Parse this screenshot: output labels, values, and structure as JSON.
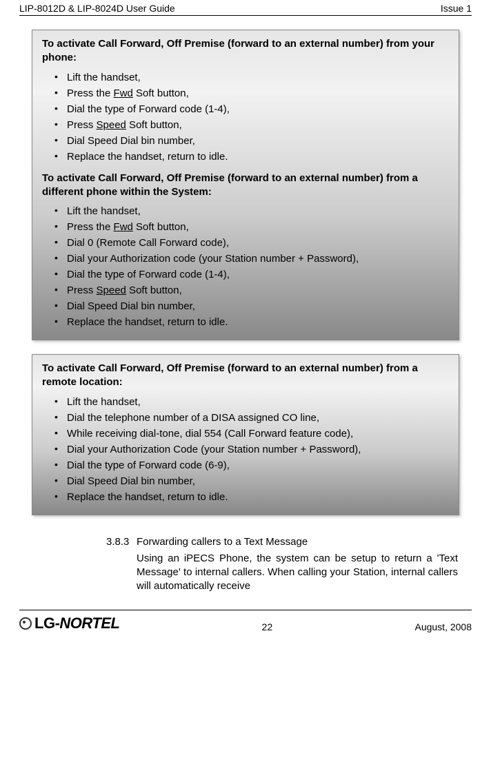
{
  "header": {
    "left": "LIP-8012D & LIP-8024D User Guide",
    "right": "Issue 1"
  },
  "box1": {
    "title": "To activate Call Forward, Off Premise (forward to an external number) from your phone:",
    "items": {
      "a": "Lift the handset,",
      "b_pre": "Press the ",
      "b_u": "Fwd",
      "b_post": " Soft button,",
      "c": "Dial the type of Forward code (1-4),",
      "d_pre": "Press ",
      "d_u": "Speed",
      "d_post": " Soft button,",
      "e": "Dial Speed Dial bin number,",
      "f": "Replace the handset, return to idle."
    },
    "subtitle": "To activate Call Forward, Off Premise (forward to an external number) from a different phone within the System:",
    "items2": {
      "a": "Lift the handset,",
      "b_pre": "Press the ",
      "b_u": "Fwd",
      "b_post": " Soft button,",
      "c": "Dial 0 (Remote Call Forward code),",
      "d": "Dial your Authorization code (your Station number + Password),",
      "e": "Dial the type of Forward code (1-4),",
      "f_pre": "Press ",
      "f_u": "Speed",
      "f_post": " Soft button,",
      "g": "Dial Speed Dial bin number,",
      "h": "Replace the handset, return to idle."
    }
  },
  "box2": {
    "title": "To activate Call Forward, Off Premise (forward to an external number) from a remote location:",
    "items": {
      "a": "Lift the handset,",
      "b": "Dial the telephone number of a DISA assigned CO line,",
      "c": "While receiving dial-tone, dial 554 (Call Forward feature code),",
      "d": "Dial your Authorization Code (your Station number + Password),",
      "e": "Dial the type of Forward code (6-9),",
      "f": "Dial Speed Dial bin number,",
      "g": "Replace the handset, return to idle."
    }
  },
  "section": {
    "number": "3.8.3",
    "title": "Forwarding callers to a Text Message",
    "body": "Using an iPECS Phone, the system can be setup to return a 'Text Message' to internal callers.  When calling your Station, internal callers will automatically receive"
  },
  "footer": {
    "logo_lg": "LG",
    "logo_nortel": "-NORTEL",
    "page": "22",
    "date": "August, 2008"
  }
}
